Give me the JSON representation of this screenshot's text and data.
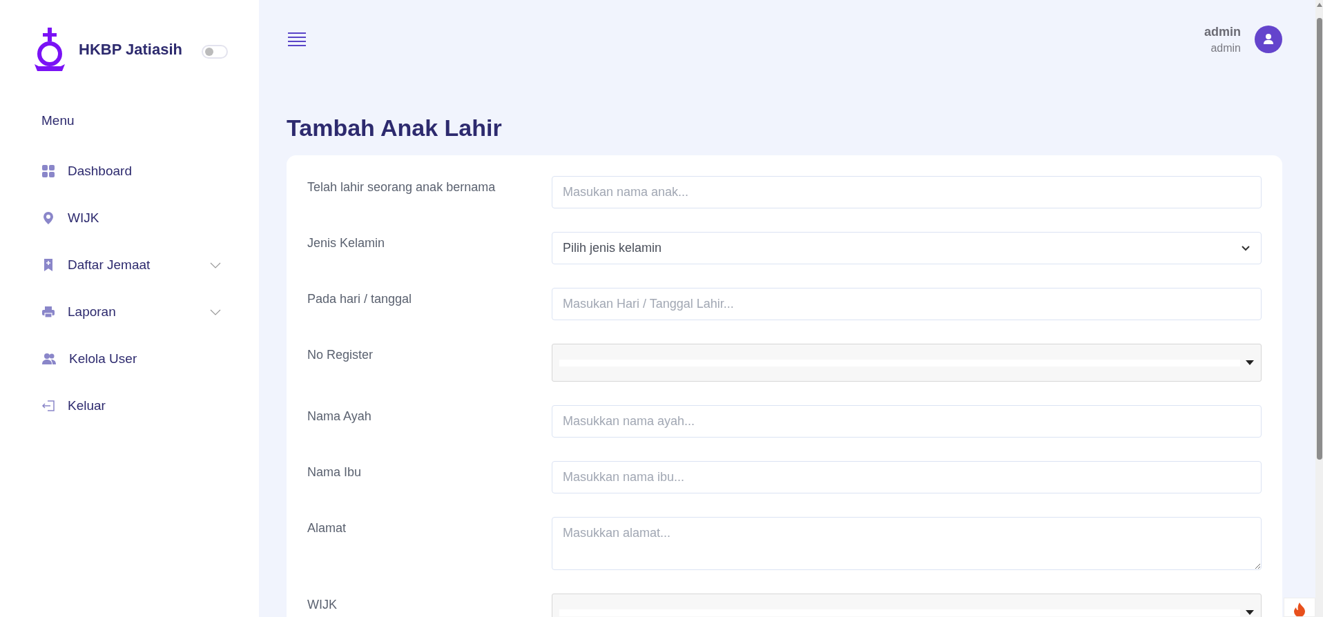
{
  "sidebar": {
    "brand": "HKBP Jatiasih",
    "theme_toggle": {
      "on": false
    },
    "menu_heading": "Menu",
    "items": [
      {
        "label": "Dashboard",
        "has_submenu": false
      },
      {
        "label": "WIJK",
        "has_submenu": false
      },
      {
        "label": "Daftar Jemaat",
        "has_submenu": true
      },
      {
        "label": "Laporan",
        "has_submenu": true
      },
      {
        "label": "Kelola User",
        "has_submenu": false
      },
      {
        "label": "Keluar",
        "has_submenu": false
      }
    ]
  },
  "header": {
    "user_name": "admin",
    "user_role": "admin"
  },
  "page_title": "Tambah Anak Lahir",
  "form": {
    "fields": [
      {
        "label": "Telah lahir seorang anak bernama",
        "kind": "text",
        "placeholder": "Masukan nama anak..."
      },
      {
        "label": "Jenis Kelamin",
        "kind": "select",
        "value": "Pilih jenis kelamin"
      },
      {
        "label": "Pada hari / tanggal",
        "kind": "text",
        "placeholder": "Masukan Hari / Tanggal Lahir..."
      },
      {
        "label": "No Register",
        "kind": "combobox"
      },
      {
        "label": "Nama Ayah",
        "kind": "text",
        "placeholder": "Masukkan nama ayah..."
      },
      {
        "label": "Nama Ibu",
        "kind": "text",
        "placeholder": "Masukkan nama ibu..."
      },
      {
        "label": "Alamat",
        "kind": "textarea",
        "placeholder": "Masukkan alamat..."
      },
      {
        "label": "WIJK",
        "kind": "combobox"
      }
    ]
  }
}
